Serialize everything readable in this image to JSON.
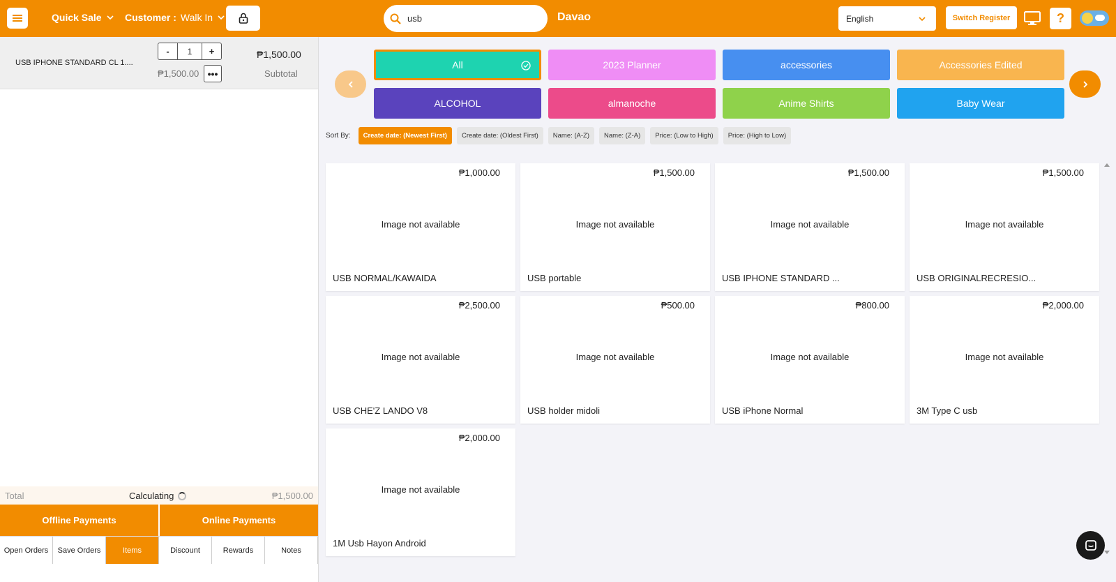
{
  "topbar": {
    "quick_sale": "Quick Sale",
    "customer_label": "Customer :",
    "customer_value": "Walk In",
    "search_value": "usb",
    "store_name": "Davao",
    "language": "English",
    "switch_register": "Switch Register",
    "help": "?"
  },
  "cart": {
    "line": {
      "name": "USB IPHONE STANDARD CL 1....",
      "qty_minus": "-",
      "qty": "1",
      "qty_plus": "+",
      "unit_price": "₱1,500.00",
      "more": "•••",
      "line_total": "₱1,500.00",
      "subtotal_label": "Subtotal"
    },
    "total_label": "Total",
    "calculating": "Calculating",
    "total_value": "₱1,500.00",
    "offline_payments": "Offline Payments",
    "online_payments": "Online Payments",
    "tabs": [
      "Open Orders",
      "Save Orders",
      "Items",
      "Discount",
      "Rewards",
      "Notes"
    ],
    "active_tab": "Items"
  },
  "categories": [
    {
      "label": "All",
      "color": "#1ed3b0",
      "selected": true
    },
    {
      "label": "2023 Planner",
      "color": "#ef8df5"
    },
    {
      "label": "accessories",
      "color": "#478ff0"
    },
    {
      "label": "Accessories Edited",
      "color": "#f9b54f"
    },
    {
      "label": "ALCOHOL",
      "color": "#5a43bd"
    },
    {
      "label": "almanoche",
      "color": "#ec4b8a"
    },
    {
      "label": "Anime Shirts",
      "color": "#8fd24b"
    },
    {
      "label": "Baby Wear",
      "color": "#20a3ef"
    }
  ],
  "sort": {
    "label": "Sort By:",
    "options": [
      "Create date: (Newest First)",
      "Create date: (Oldest First)",
      "Name: (A-Z)",
      "Name: (Z-A)",
      "Price: (Low to High)",
      "Price: (High to Low)"
    ],
    "active": "Create date: (Newest First)"
  },
  "products": [
    {
      "price": "₱1,000.00",
      "image_text": "Image not available",
      "name": "USB NORMAL/KAWAIDA"
    },
    {
      "price": "₱1,500.00",
      "image_text": "Image not available",
      "name": "USB portable"
    },
    {
      "price": "₱1,500.00",
      "image_text": "Image not available",
      "name": "USB IPHONE STANDARD ..."
    },
    {
      "price": "₱1,500.00",
      "image_text": "Image not available",
      "name": "USB ORIGINALRECRESIO..."
    },
    {
      "price": "₱2,500.00",
      "image_text": "Image not available",
      "name": "USB CHE'Z LANDO V8"
    },
    {
      "price": "₱500.00",
      "image_text": "Image not available",
      "name": "USB holder midoli"
    },
    {
      "price": "₱800.00",
      "image_text": "Image not available",
      "name": "USB iPhone Normal"
    },
    {
      "price": "₱2,000.00",
      "image_text": "Image not available",
      "name": "3M Type C usb"
    },
    {
      "price": "₱2,000.00",
      "image_text": "Image not available",
      "name": "1M Usb Hayon Android"
    }
  ],
  "colors": {
    "accent": "#f28c00",
    "background": "#f3f3f8"
  }
}
